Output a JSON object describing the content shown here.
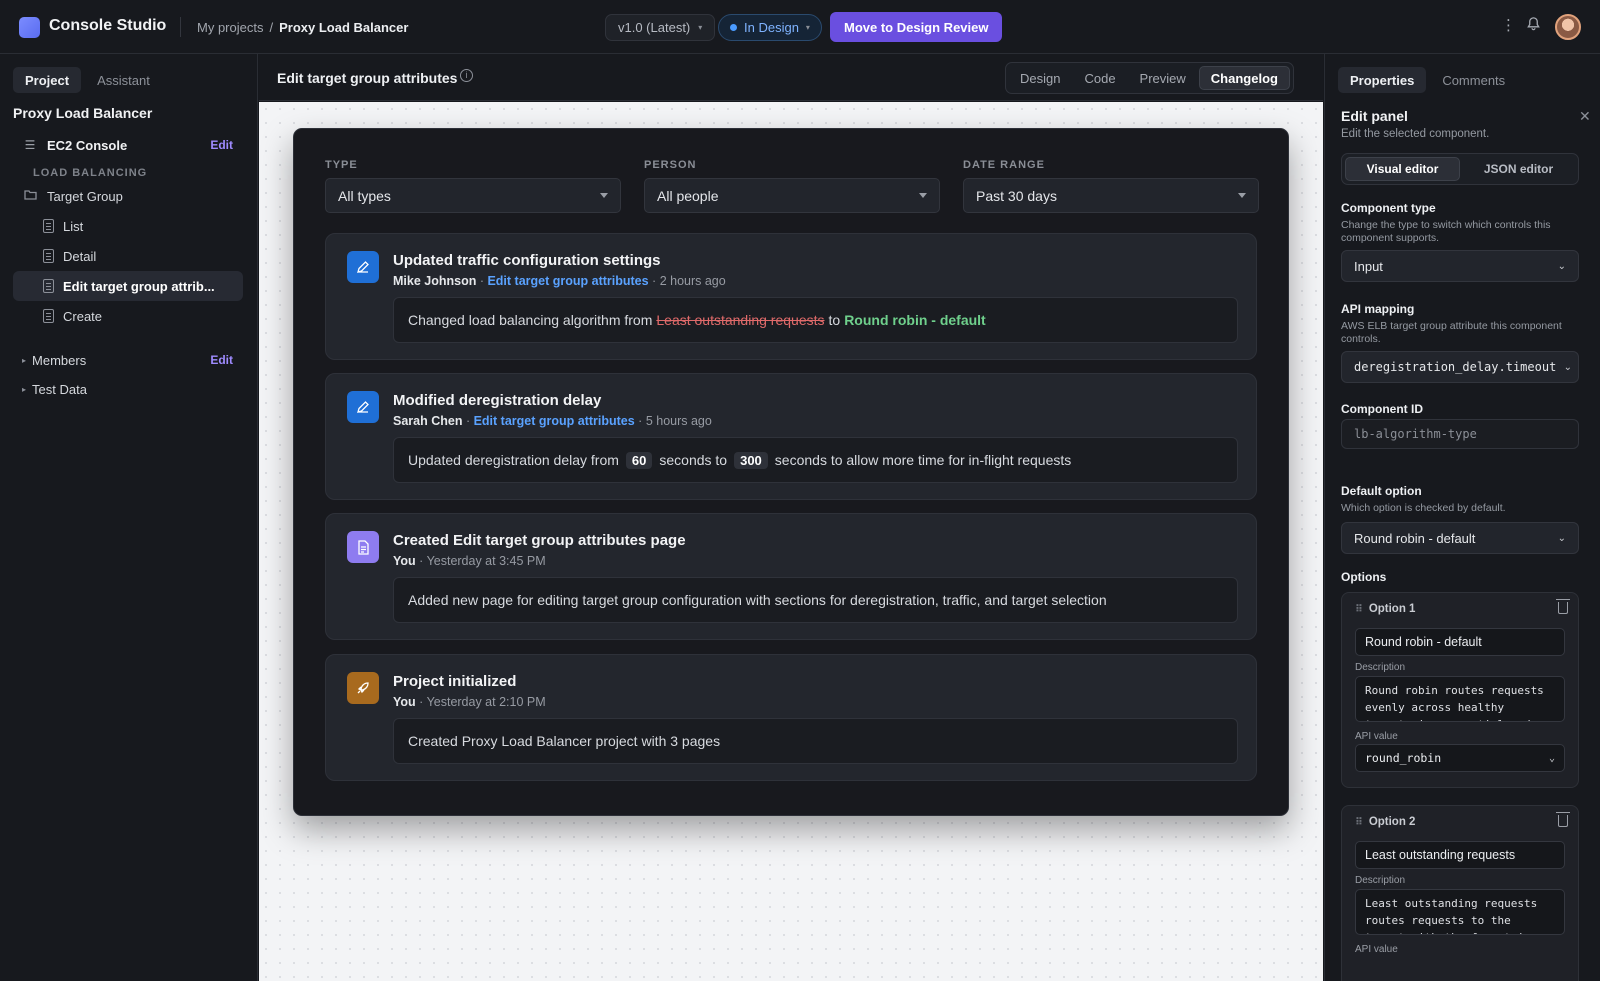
{
  "app": {
    "name": "Console Studio"
  },
  "breadcrumb": {
    "root": "My projects",
    "separator": "/",
    "current": "Proxy Load Balancer"
  },
  "header": {
    "version": "v1.0 (Latest)",
    "status": "In Design",
    "primary_action": "Move to Design Review",
    "icons": [
      "more-vertical-icon",
      "bell-icon",
      "avatar"
    ]
  },
  "sidebar": {
    "tabs": [
      "Project",
      "Assistant"
    ],
    "active_tab": "Project",
    "project_title": "Proxy Load Balancer",
    "console": {
      "label": "EC2 Console",
      "edit": "Edit"
    },
    "section": "LOAD BALANCING",
    "group": "Target Group",
    "pages": [
      "List",
      "Detail",
      "Edit target group attrib...",
      "Create"
    ],
    "active_page": "Edit target group attrib...",
    "members": {
      "label": "Members",
      "edit": "Edit"
    },
    "test_data": "Test Data"
  },
  "center": {
    "page_title": "Edit target group attributes",
    "view_tabs": [
      "Design",
      "Code",
      "Preview",
      "Changelog"
    ],
    "active_view": "Changelog"
  },
  "filters": {
    "type": {
      "label": "TYPE",
      "value": "All types"
    },
    "person": {
      "label": "PERSON",
      "value": "All people"
    },
    "date": {
      "label": "DATE RANGE",
      "value": "Past 30 days"
    }
  },
  "changelog": [
    {
      "title": "Updated traffic configuration settings",
      "author": "Mike Johnson",
      "page_link": "Edit target group attributes",
      "time": "2 hours ago",
      "icon": "pencil-icon",
      "color": "#1f6fd6",
      "body": {
        "pre": "Changed load balancing algorithm from",
        "old": "Least outstanding requests",
        "mid": "to",
        "new": "Round robin - default"
      }
    },
    {
      "title": "Modified deregistration delay",
      "author": "Sarah Chen",
      "page_link": "Edit target group attributes",
      "time": "5 hours ago",
      "icon": "pencil-icon",
      "color": "#1f6fd6",
      "body": {
        "pre": "Updated deregistration delay from",
        "old": "60",
        "mid": "seconds to",
        "new": "300",
        "post": "seconds to allow more time for in-flight requests"
      }
    },
    {
      "title": "Created Edit target group attributes page",
      "author": "You",
      "time": "Yesterday at 3:45 PM",
      "icon": "document-icon",
      "color": "#8e7cf0",
      "body": {
        "text": "Added new page for editing target group configuration with sections for deregistration, traffic, and target selection"
      }
    },
    {
      "title": "Project initialized",
      "author": "You",
      "time": "Yesterday at 2:10 PM",
      "icon": "rocket-icon",
      "color": "#a86a1e",
      "body": {
        "text": "Created Proxy Load Balancer project with 3 pages"
      }
    }
  ],
  "rpanel": {
    "tabs": [
      "Properties",
      "Comments"
    ],
    "active_tab": "Properties",
    "title": "Edit panel",
    "subtitle": "Edit the selected component.",
    "modes": [
      "Visual editor",
      "JSON editor"
    ],
    "active_mode": "Visual editor",
    "component_type": {
      "label": "Component type",
      "help": "Change the type to switch which controls this component supports.",
      "value": "Input"
    },
    "api_mapping": {
      "label": "API mapping",
      "help": "AWS ELB target group attribute this component controls.",
      "value": "deregistration_delay.timeout_seconds"
    },
    "component_id": {
      "label": "Component ID",
      "placeholder": "lb-algorithm-type"
    },
    "default_option": {
      "label": "Default option",
      "help": "Which option is checked by default.",
      "value": "Round robin - default"
    },
    "options_label": "Options",
    "options": [
      {
        "head": "Option 1",
        "label": "Round robin - default",
        "desc_label": "Description",
        "desc": "Round robin routes requests evenly across healthy targets in sequential order.",
        "api_label": "API value",
        "api": "round_robin"
      },
      {
        "head": "Option 2",
        "label": "Least outstanding requests",
        "desc_label": "Description",
        "desc": "Least outstanding requests routes requests to the target with the fewest in-progress requests.",
        "api_label": "API value"
      }
    ]
  }
}
